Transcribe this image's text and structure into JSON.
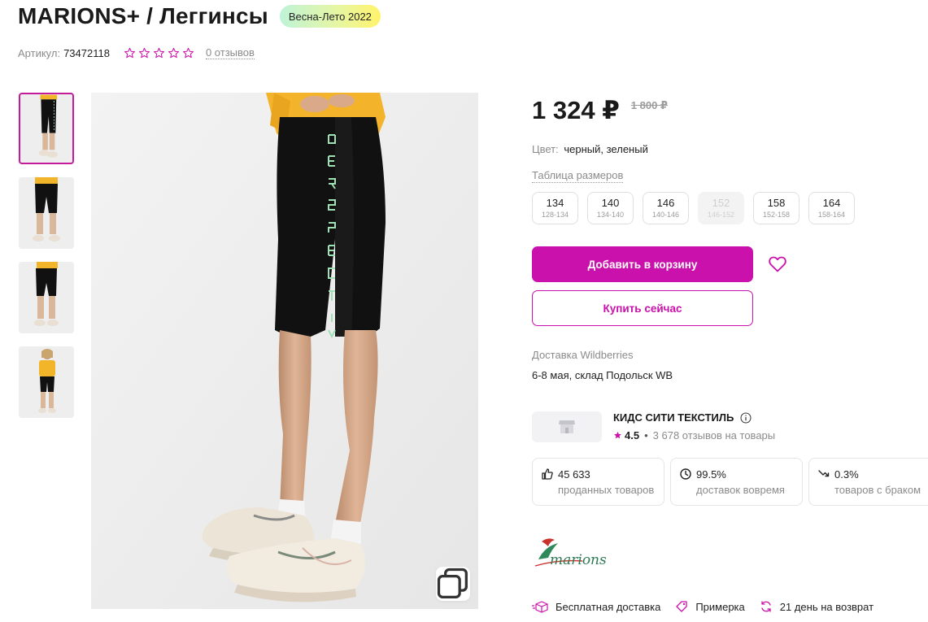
{
  "product": {
    "title": "MARIONS+ / Леггинсы",
    "season_badge": "Весна-Лето 2022",
    "article_label": "Артикул:",
    "article_value": "73472118",
    "rating_stars": 0,
    "reviews_link": "0 отзывов"
  },
  "price": {
    "current": "1 324 ₽",
    "old": "1 800 ₽"
  },
  "color": {
    "label": "Цвет:",
    "value": "черный, зеленый"
  },
  "size_table_link": "Таблица размеров",
  "sizes": [
    {
      "ru": "134",
      "range": "128-134",
      "available": true
    },
    {
      "ru": "140",
      "range": "134-140",
      "available": true
    },
    {
      "ru": "146",
      "range": "140-146",
      "available": true
    },
    {
      "ru": "152",
      "range": "146-152",
      "available": false
    },
    {
      "ru": "158",
      "range": "152-158",
      "available": true
    },
    {
      "ru": "164",
      "range": "158-164",
      "available": true
    }
  ],
  "actions": {
    "add_to_cart": "Добавить в корзину",
    "buy_now": "Купить сейчас"
  },
  "delivery": {
    "label": "Доставка Wildberries",
    "value": "6-8 мая, склад Подольск WB"
  },
  "seller": {
    "name": "КИДС СИТИ ТЕКСТИЛЬ",
    "rating": "4.5",
    "reviews": "3 678 отзывов на товары"
  },
  "stats": [
    {
      "icon": "thumbs-up-icon",
      "value": "45 633",
      "label": "проданных товаров"
    },
    {
      "icon": "clock-icon",
      "value": "99.5%",
      "label": "доставок вовремя"
    },
    {
      "icon": "trend-down-icon",
      "value": "0.3%",
      "label": "товаров с браком"
    }
  ],
  "features": [
    {
      "icon": "free-delivery-icon",
      "label": "Бесплатная доставка"
    },
    {
      "icon": "tag-icon",
      "label": "Примерка"
    },
    {
      "icon": "return-icon",
      "label": "21 день на возврат"
    }
  ],
  "colors": {
    "accent": "#cb11ab",
    "text": "#1a1a1a",
    "muted": "#8b8b8b"
  }
}
